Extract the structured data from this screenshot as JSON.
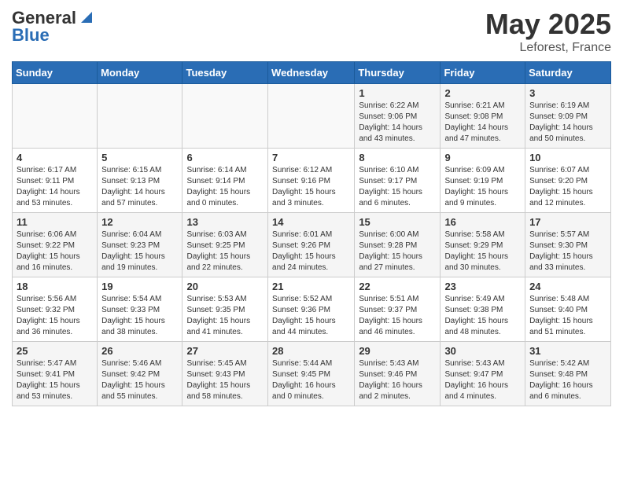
{
  "header": {
    "logo_general": "General",
    "logo_blue": "Blue",
    "title_month": "May 2025",
    "title_location": "Leforest, France"
  },
  "days_of_week": [
    "Sunday",
    "Monday",
    "Tuesday",
    "Wednesday",
    "Thursday",
    "Friday",
    "Saturday"
  ],
  "weeks": [
    [
      {
        "day": "",
        "info": ""
      },
      {
        "day": "",
        "info": ""
      },
      {
        "day": "",
        "info": ""
      },
      {
        "day": "",
        "info": ""
      },
      {
        "day": "1",
        "info": "Sunrise: 6:22 AM\nSunset: 9:06 PM\nDaylight: 14 hours and 43 minutes."
      },
      {
        "day": "2",
        "info": "Sunrise: 6:21 AM\nSunset: 9:08 PM\nDaylight: 14 hours and 47 minutes."
      },
      {
        "day": "3",
        "info": "Sunrise: 6:19 AM\nSunset: 9:09 PM\nDaylight: 14 hours and 50 minutes."
      }
    ],
    [
      {
        "day": "4",
        "info": "Sunrise: 6:17 AM\nSunset: 9:11 PM\nDaylight: 14 hours and 53 minutes."
      },
      {
        "day": "5",
        "info": "Sunrise: 6:15 AM\nSunset: 9:13 PM\nDaylight: 14 hours and 57 minutes."
      },
      {
        "day": "6",
        "info": "Sunrise: 6:14 AM\nSunset: 9:14 PM\nDaylight: 15 hours and 0 minutes."
      },
      {
        "day": "7",
        "info": "Sunrise: 6:12 AM\nSunset: 9:16 PM\nDaylight: 15 hours and 3 minutes."
      },
      {
        "day": "8",
        "info": "Sunrise: 6:10 AM\nSunset: 9:17 PM\nDaylight: 15 hours and 6 minutes."
      },
      {
        "day": "9",
        "info": "Sunrise: 6:09 AM\nSunset: 9:19 PM\nDaylight: 15 hours and 9 minutes."
      },
      {
        "day": "10",
        "info": "Sunrise: 6:07 AM\nSunset: 9:20 PM\nDaylight: 15 hours and 12 minutes."
      }
    ],
    [
      {
        "day": "11",
        "info": "Sunrise: 6:06 AM\nSunset: 9:22 PM\nDaylight: 15 hours and 16 minutes."
      },
      {
        "day": "12",
        "info": "Sunrise: 6:04 AM\nSunset: 9:23 PM\nDaylight: 15 hours and 19 minutes."
      },
      {
        "day": "13",
        "info": "Sunrise: 6:03 AM\nSunset: 9:25 PM\nDaylight: 15 hours and 22 minutes."
      },
      {
        "day": "14",
        "info": "Sunrise: 6:01 AM\nSunset: 9:26 PM\nDaylight: 15 hours and 24 minutes."
      },
      {
        "day": "15",
        "info": "Sunrise: 6:00 AM\nSunset: 9:28 PM\nDaylight: 15 hours and 27 minutes."
      },
      {
        "day": "16",
        "info": "Sunrise: 5:58 AM\nSunset: 9:29 PM\nDaylight: 15 hours and 30 minutes."
      },
      {
        "day": "17",
        "info": "Sunrise: 5:57 AM\nSunset: 9:30 PM\nDaylight: 15 hours and 33 minutes."
      }
    ],
    [
      {
        "day": "18",
        "info": "Sunrise: 5:56 AM\nSunset: 9:32 PM\nDaylight: 15 hours and 36 minutes."
      },
      {
        "day": "19",
        "info": "Sunrise: 5:54 AM\nSunset: 9:33 PM\nDaylight: 15 hours and 38 minutes."
      },
      {
        "day": "20",
        "info": "Sunrise: 5:53 AM\nSunset: 9:35 PM\nDaylight: 15 hours and 41 minutes."
      },
      {
        "day": "21",
        "info": "Sunrise: 5:52 AM\nSunset: 9:36 PM\nDaylight: 15 hours and 44 minutes."
      },
      {
        "day": "22",
        "info": "Sunrise: 5:51 AM\nSunset: 9:37 PM\nDaylight: 15 hours and 46 minutes."
      },
      {
        "day": "23",
        "info": "Sunrise: 5:49 AM\nSunset: 9:38 PM\nDaylight: 15 hours and 48 minutes."
      },
      {
        "day": "24",
        "info": "Sunrise: 5:48 AM\nSunset: 9:40 PM\nDaylight: 15 hours and 51 minutes."
      }
    ],
    [
      {
        "day": "25",
        "info": "Sunrise: 5:47 AM\nSunset: 9:41 PM\nDaylight: 15 hours and 53 minutes."
      },
      {
        "day": "26",
        "info": "Sunrise: 5:46 AM\nSunset: 9:42 PM\nDaylight: 15 hours and 55 minutes."
      },
      {
        "day": "27",
        "info": "Sunrise: 5:45 AM\nSunset: 9:43 PM\nDaylight: 15 hours and 58 minutes."
      },
      {
        "day": "28",
        "info": "Sunrise: 5:44 AM\nSunset: 9:45 PM\nDaylight: 16 hours and 0 minutes."
      },
      {
        "day": "29",
        "info": "Sunrise: 5:43 AM\nSunset: 9:46 PM\nDaylight: 16 hours and 2 minutes."
      },
      {
        "day": "30",
        "info": "Sunrise: 5:43 AM\nSunset: 9:47 PM\nDaylight: 16 hours and 4 minutes."
      },
      {
        "day": "31",
        "info": "Sunrise: 5:42 AM\nSunset: 9:48 PM\nDaylight: 16 hours and 6 minutes."
      }
    ]
  ]
}
